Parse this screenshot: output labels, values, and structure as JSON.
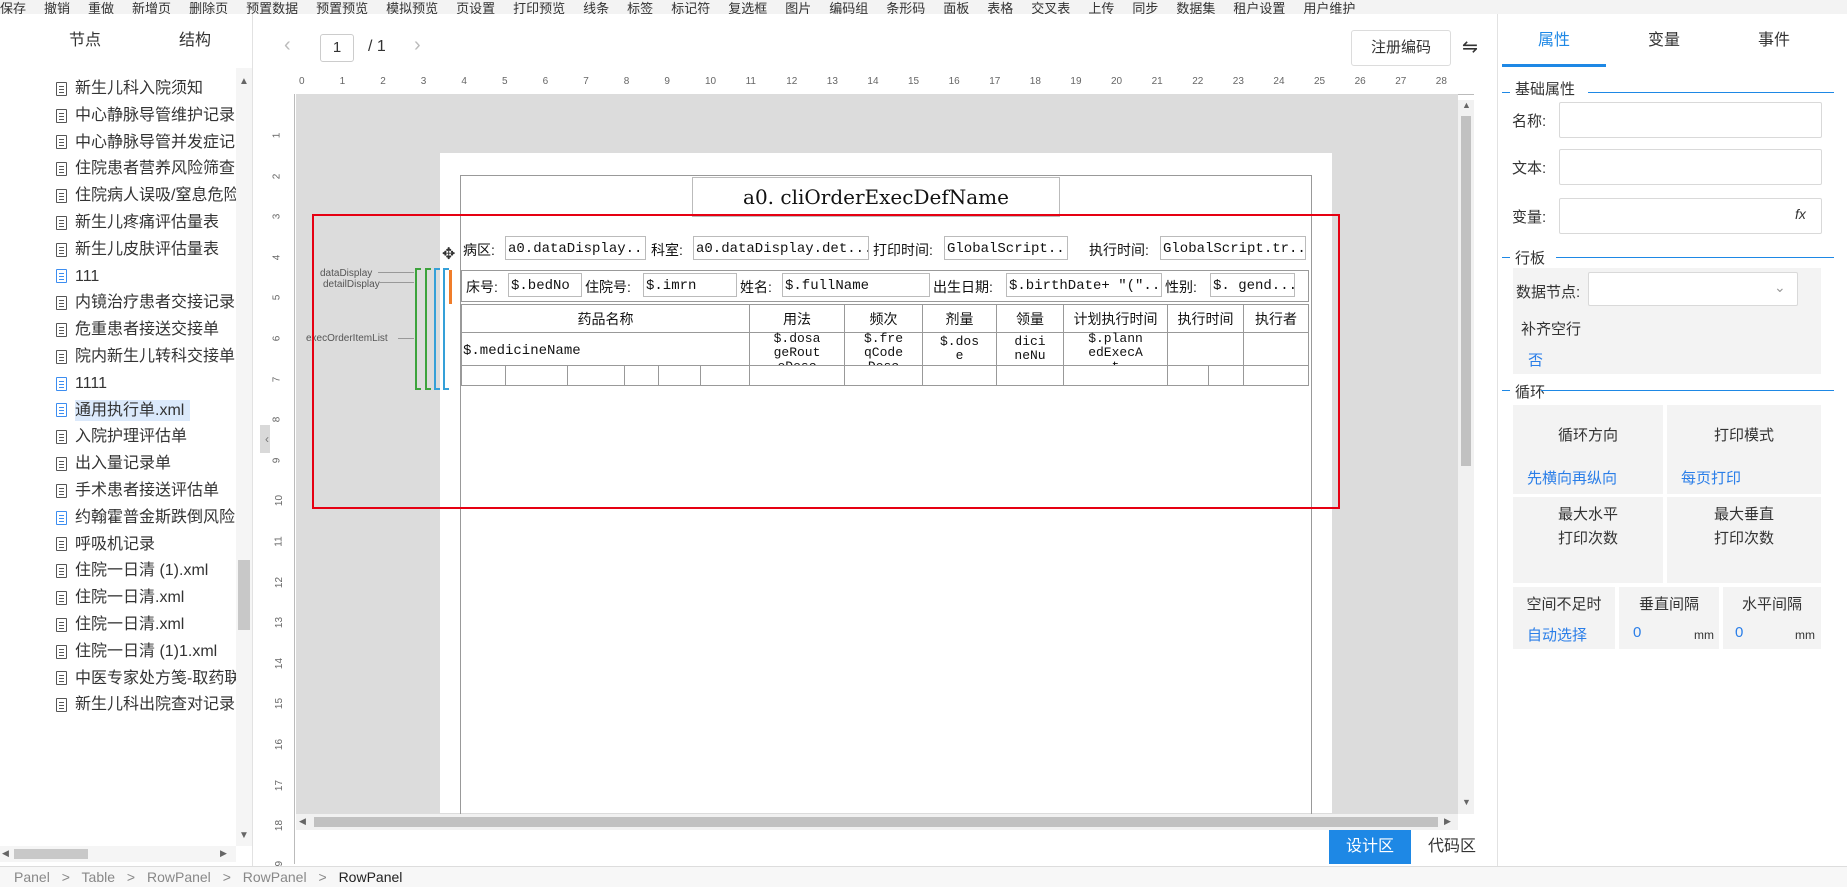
{
  "menubar": [
    "保存",
    "撤销",
    "重做",
    "新增页",
    "删除页",
    "预置数据",
    "预置预览",
    "模拟预览",
    "页设置",
    "打印预览",
    "线条",
    "标签",
    "标记符",
    "复选框",
    "图片",
    "编码组",
    "条形码",
    "面板",
    "表格",
    "交叉表",
    "上传",
    "同步",
    "数据集",
    "租户设置",
    "用户维护"
  ],
  "left_panel": {
    "tabs": [
      "节点",
      "结构"
    ],
    "tree_items": [
      {
        "label": "新生儿科入院须知",
        "icon": "doc"
      },
      {
        "label": "中心静脉导管维护记录",
        "icon": "doc"
      },
      {
        "label": "中心静脉导管并发症记",
        "icon": "doc"
      },
      {
        "label": "住院患者营养风险筛查",
        "icon": "doc"
      },
      {
        "label": "住院病人误吸/窒息危险",
        "icon": "doc"
      },
      {
        "label": "新生儿疼痛评估量表",
        "icon": "doc"
      },
      {
        "label": "新生儿皮肤评估量表",
        "icon": "doc"
      },
      {
        "label": "111",
        "icon": "doc-blue"
      },
      {
        "label": "内镜治疗患者交接记录",
        "icon": "doc"
      },
      {
        "label": "危重患者接送交接单",
        "icon": "doc"
      },
      {
        "label": "院内新生儿转科交接单",
        "icon": "doc"
      },
      {
        "label": "1111",
        "icon": "doc-blue"
      },
      {
        "label": "通用执行单.xml",
        "icon": "doc-blue",
        "selected": true
      },
      {
        "label": "入院护理评估单",
        "icon": "doc"
      },
      {
        "label": "出入量记录单",
        "icon": "doc"
      },
      {
        "label": "手术患者接送评估单",
        "icon": "doc"
      },
      {
        "label": "约翰霍普金斯跌倒风险",
        "icon": "doc-blue"
      },
      {
        "label": "呼吸机记录",
        "icon": "doc"
      },
      {
        "label": "住院一日清 (1).xml",
        "icon": "doc"
      },
      {
        "label": "住院一日清.xml",
        "icon": "doc"
      },
      {
        "label": "住院一日清.xml",
        "icon": "doc"
      },
      {
        "label": "住院一日清 (1)1.xml",
        "icon": "doc"
      },
      {
        "label": "中医专家处方笺-取药联",
        "icon": "doc"
      },
      {
        "label": "新生儿科出院查对记录",
        "icon": "doc"
      }
    ]
  },
  "toolbar": {
    "page_current": "1",
    "page_total": "/ 1",
    "register_button": "注册编码",
    "prev_icon": "chevron-left-icon",
    "next_icon": "chevron-right-icon",
    "swap_icon": "swap-icon"
  },
  "ruler": {
    "top": [
      "0",
      "1",
      "2",
      "3",
      "4",
      "5",
      "6",
      "7",
      "8",
      "9",
      "10",
      "11",
      "12",
      "13",
      "14",
      "15",
      "16",
      "17",
      "18",
      "19",
      "20",
      "21",
      "22",
      "23",
      "24",
      "25",
      "26",
      "27",
      "28"
    ],
    "left": [
      "1",
      "2",
      "3",
      "4",
      "5",
      "6",
      "7",
      "8",
      "9",
      "10",
      "11",
      "12",
      "13",
      "14",
      "15",
      "16",
      "17",
      "18",
      "19"
    ]
  },
  "design": {
    "title": "a0. cliOrderExecDefName",
    "row1": [
      {
        "label": "病区:",
        "value": "a0.dataDisplay..."
      },
      {
        "label": "科室:",
        "value": "a0.dataDisplay.det..."
      },
      {
        "label": "打印时间:",
        "value": "GlobalScript..."
      },
      {
        "label": "执行时间:",
        "value": "GlobalScript.tr..."
      }
    ],
    "row2": [
      {
        "label": "床号:",
        "value": "$.bedNo"
      },
      {
        "label": "住院号:",
        "value": "$.imrn"
      },
      {
        "label": "姓名:",
        "value": "$.fullName"
      },
      {
        "label": "出生日期:",
        "value": "$.birthDate+ \"(\"..."
      },
      {
        "label": "性别:",
        "value": "$. gend..."
      }
    ],
    "table_headers": [
      "药品名称",
      "用法",
      "频次",
      "剂量",
      "领量",
      "计划执行时间",
      "执行时间",
      "执行者"
    ],
    "table_row": [
      "$.medicineName",
      "$.dosa\ngeRout\neDesc",
      "$.fre\nqCode\nDesc",
      "$.dos\ne",
      "dici\nneNu\nm",
      "$.plann\nedExecA\nt",
      "",
      ""
    ],
    "side_tags": [
      "dataDisplay",
      "detailDisplay",
      "execOrderItemList"
    ]
  },
  "bottom_tabs": {
    "design": "设计区",
    "code": "代码区"
  },
  "breadcrumb": [
    "Panel",
    ">",
    "Table",
    ">",
    "RowPanel",
    ">",
    "RowPanel",
    ">",
    "RowPanel"
  ],
  "right_panel": {
    "tabs": [
      "属性",
      "变量",
      "事件"
    ],
    "active_tab": "属性",
    "basic_section": "基础属性",
    "name_label": "名称:",
    "text_label": "文本:",
    "var_label": "变量:",
    "fx": "fx",
    "row_section": "行板",
    "data_node_label": "数据节点:",
    "fill_empty_label": "补齐空行",
    "fill_empty_value": "否",
    "loop_section": "循环",
    "loop_direction_label": "循环方向",
    "loop_direction_value": "先横向再纵向",
    "print_mode_label": "打印模式",
    "print_mode_value": "每页打印",
    "max_h_label": "最大水平\n打印次数",
    "max_v_label": "最大垂直\n打印次数",
    "space_label": "空间不足时",
    "space_value": "自动选择",
    "vgap_label": "垂直间隔",
    "vgap_value": "0",
    "hgap_label": "水平间隔",
    "hgap_value": "0",
    "unit": "mm",
    "accent_color": "#1e88e5"
  }
}
